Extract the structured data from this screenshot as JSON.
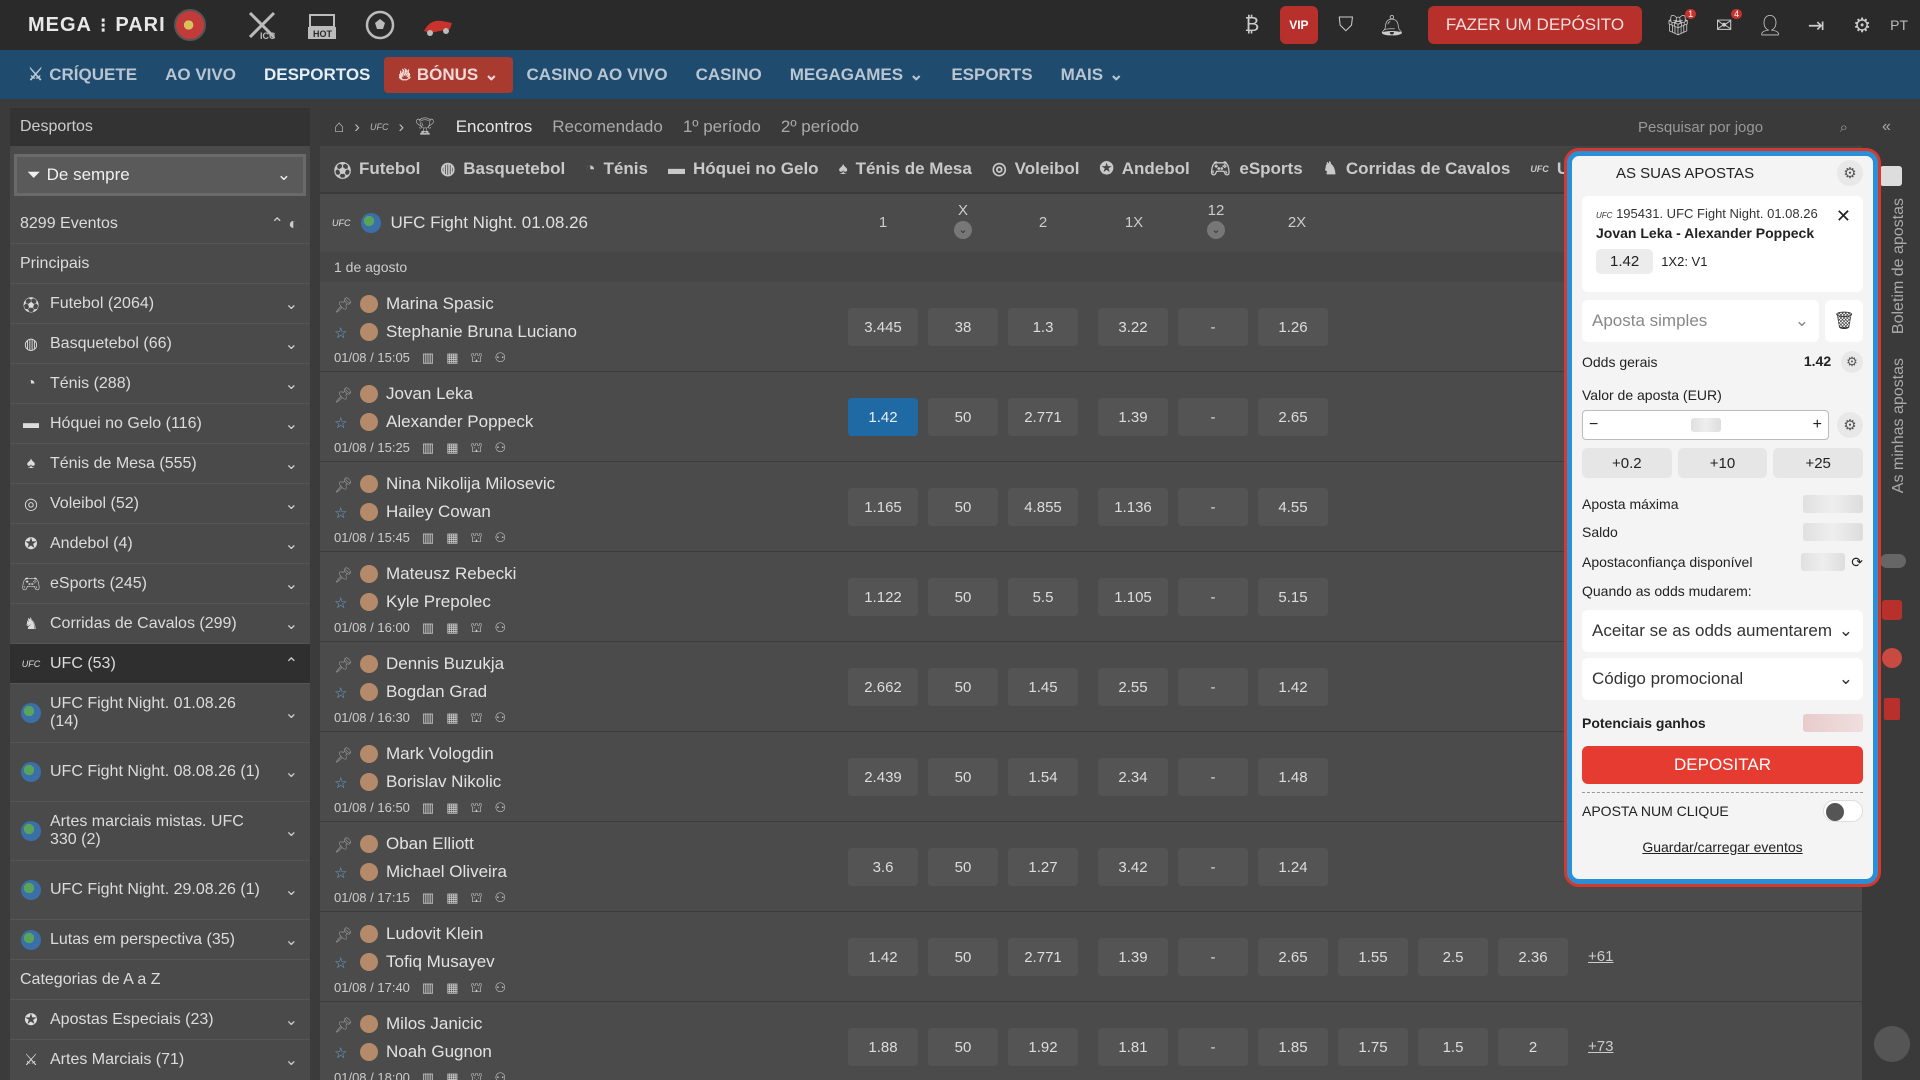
{
  "topbar": {
    "logo_left": "MEGA",
    "logo_right": "PARI",
    "promo_icc": "ICC",
    "promo_hot": "HOT",
    "vip": "VIP",
    "deposit": "FAZER UM DEPÓSITO",
    "gift_badge": "1",
    "mail_badge": "4",
    "lang": "PT"
  },
  "nav": {
    "items": [
      "CRÍQUETE",
      "AO VIVO",
      "DESPORTOS",
      "BÓNUS",
      "CASINO AO VIVO",
      "CASINO",
      "MEGAGAMES",
      "ESPORTS",
      "MAIS"
    ]
  },
  "sidebar": {
    "title": "Desportos",
    "filter": "De sempre",
    "events": "8299 Eventos",
    "principais": "Principais",
    "sports": [
      "Futebol (2064)",
      "Basquetebol (66)",
      "Ténis (288)",
      "Hóquei no Gelo (116)",
      "Ténis de Mesa (555)",
      "Voleibol (52)",
      "Andebol (4)",
      "eSports (245)",
      "Corridas de Cavalos (299)"
    ],
    "ufc": "UFC (53)",
    "ufc_items": [
      "UFC Fight Night. 01.08.26 (14)",
      "UFC Fight Night. 08.08.26 (1)",
      "Artes marciais mistas. UFC 330 (2)",
      "UFC Fight Night. 29.08.26 (1)",
      "Lutas em perspectiva (35)"
    ],
    "categories": "Categorias de A a Z",
    "extra": [
      "Apostas Especiais (23)",
      "Artes Marciais (71)"
    ]
  },
  "main": {
    "crumb_tabs": [
      "Encontros",
      "Recomendado",
      "1º período",
      "2º período"
    ],
    "search_placeholder": "Pesquisar por jogo",
    "sport_tabs": [
      "Futebol",
      "Basquetebol",
      "Ténis",
      "Hóquei no Gelo",
      "Ténis de Mesa",
      "Voleibol",
      "Andebol",
      "eSports",
      "Corridas de Cavalos",
      "UF"
    ],
    "league": "UFC Fight Night. 01.08.26",
    "columns": [
      "1",
      "X",
      "2",
      "1X",
      "12",
      "2X"
    ],
    "date": "1 de agosto",
    "matches": [
      {
        "t1": "Marina Spasic",
        "t2": "Stephanie Bruna Luciano",
        "time": "01/08 / 15:05",
        "odds": [
          "3.445",
          "38",
          "1.3",
          "3.22",
          "-",
          "1.26"
        ]
      },
      {
        "t1": "Jovan Leka",
        "t2": "Alexander Poppeck",
        "time": "01/08 / 15:25",
        "odds": [
          "1.42",
          "50",
          "2.771",
          "1.39",
          "-",
          "2.65"
        ]
      },
      {
        "t1": "Nina Nikolija Milosevic",
        "t2": "Hailey Cowan",
        "time": "01/08 / 15:45",
        "odds": [
          "1.165",
          "50",
          "4.855",
          "1.136",
          "-",
          "4.55"
        ]
      },
      {
        "t1": "Mateusz Rebecki",
        "t2": "Kyle Prepolec",
        "time": "01/08 / 16:00",
        "odds": [
          "1.122",
          "50",
          "5.5",
          "1.105",
          "-",
          "5.15"
        ]
      },
      {
        "t1": "Dennis Buzukja",
        "t2": "Bogdan Grad",
        "time": "01/08 / 16:30",
        "odds": [
          "2.662",
          "50",
          "1.45",
          "2.55",
          "-",
          "1.42"
        ]
      },
      {
        "t1": "Mark Vologdin",
        "t2": "Borislav Nikolic",
        "time": "01/08 / 16:50",
        "odds": [
          "2.439",
          "50",
          "1.54",
          "2.34",
          "-",
          "1.48"
        ]
      },
      {
        "t1": "Oban Elliott",
        "t2": "Michael Oliveira",
        "time": "01/08 / 17:15",
        "odds": [
          "3.6",
          "50",
          "1.27",
          "3.42",
          "-",
          "1.24"
        ]
      },
      {
        "t1": "Ludovit Klein",
        "t2": "Tofiq Musayev",
        "time": "01/08 / 17:40",
        "odds": [
          "1.42",
          "50",
          "2.771",
          "1.39",
          "-",
          "2.65",
          "1.55",
          "2.5",
          "2.36"
        ],
        "more": "+61"
      },
      {
        "t1": "Milos Janicic",
        "t2": "Noah Gugnon",
        "time": "01/08 / 18:00",
        "odds": [
          "1.88",
          "50",
          "1.92",
          "1.81",
          "-",
          "1.85",
          "1.75",
          "1.5",
          "2"
        ],
        "more": "+73"
      }
    ]
  },
  "strip": {
    "boletim": "Boletim de apostas",
    "minhas": "As minhas apostas"
  },
  "slip": {
    "title": "AS SUAS APOSTAS",
    "event": "195431. UFC Fight Night. 01.08.26",
    "teams": "Jovan Leka - Alexander Poppeck",
    "odd": "1.42",
    "market": "1X2: V1",
    "type": "Aposta simples",
    "total_label": "Odds gerais",
    "total": "1.42",
    "stake_label": "Valor de aposta (EUR)",
    "quick": [
      "+0.2",
      "+10",
      "+25"
    ],
    "max_label": "Aposta máxima",
    "saldo_label": "Saldo",
    "confianca_label": "Apostaconfiança disponível",
    "change_label": "Quando as odds mudarem:",
    "change_option": "Aceitar se as odds aumentarem",
    "promo": "Código promocional",
    "potential": "Potenciais ganhos",
    "deposit": "DEPOSITAR",
    "oneclick": "APOSTA NUM CLIQUE",
    "save": "Guardar/carregar eventos"
  }
}
